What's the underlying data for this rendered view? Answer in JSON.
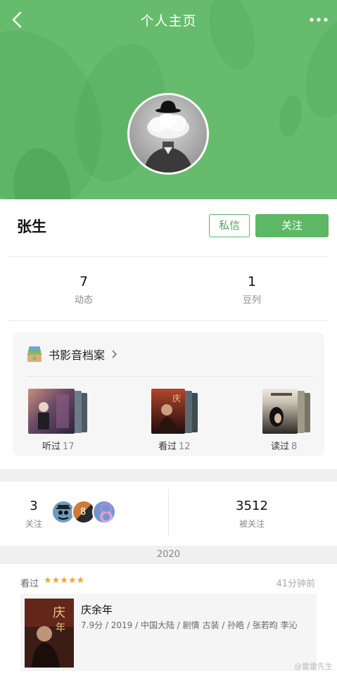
{
  "nav": {
    "title": "个人主页",
    "back_icon": "back-chevron-icon",
    "more_icon": "more-dots-icon"
  },
  "colors": {
    "header_green": "#67bb6d",
    "button_green": "#5cb865",
    "star_color": "#f5a623"
  },
  "profile": {
    "name": "张生",
    "message_button": "私信",
    "follow_button": "关注"
  },
  "stats": [
    {
      "value": "7",
      "label": "动态"
    },
    {
      "value": "1",
      "label": "豆列"
    }
  ],
  "archive": {
    "title": "书影音档案",
    "icon": "archive-box-icon",
    "shelves": [
      {
        "label": "听过",
        "count": "17"
      },
      {
        "label": "看过",
        "count": "12"
      },
      {
        "label": "读过",
        "count": "8"
      }
    ]
  },
  "follow": {
    "following_count": "3",
    "following_label": "关注",
    "followers_count": "3512",
    "followers_label": "被关注"
  },
  "timeline": {
    "year": "2020",
    "activity": {
      "verb": "看过",
      "stars": "★★★★★",
      "time": "41分钟前",
      "item_title": "庆余年",
      "item_meta": "7.9分 / 2019 / 中国大陆 / 剧情 古装 / 孙皓 / 张若昀 李沁"
    }
  },
  "watermark": "@雷雷先生"
}
